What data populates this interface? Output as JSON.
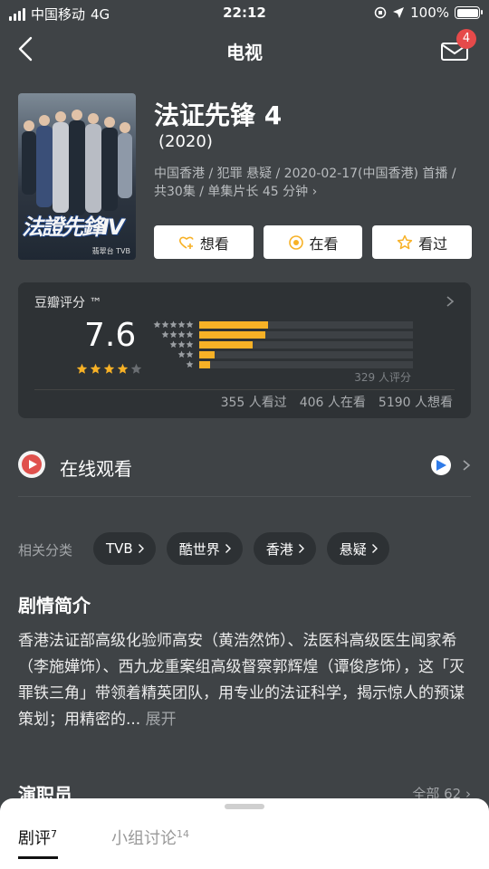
{
  "status_bar": {
    "carrier": "中国移动",
    "network": "4G",
    "time": "22:12",
    "battery_percent": "100%",
    "battery_level": 1.0
  },
  "nav": {
    "title": "电视",
    "mail_badge": "4",
    "icons": [
      "back-arrow-icon",
      "mail-icon"
    ]
  },
  "movie": {
    "title": "法证先锋 4",
    "year": "(2020)",
    "meta": "中国香港 / 犯罪 悬疑 / 2020-02-17(中国香港) 首播 / 共30集 / 单集片长 45 分钟",
    "poster": {
      "logo_text": "法證先鋒IV",
      "channel": "翡翠台 TVB"
    }
  },
  "actions": [
    {
      "label": "想看",
      "icon": "heart-plus-icon"
    },
    {
      "label": "在看",
      "icon": "target-icon"
    },
    {
      "label": "看过",
      "icon": "star-outline-icon"
    }
  ],
  "rating": {
    "label": "豆瓣评分 ™",
    "score": "7.6",
    "stars": 4,
    "distribution": [
      {
        "stars": 5,
        "percent": 32
      },
      {
        "stars": 4,
        "percent": 31
      },
      {
        "stars": 3,
        "percent": 25
      },
      {
        "stars": 2,
        "percent": 7
      },
      {
        "stars": 1,
        "percent": 5
      }
    ],
    "count": "329 人评分",
    "stats": [
      "355 人看过",
      "406 人在看",
      "5190 人想看"
    ]
  },
  "online": {
    "label": "在线观看"
  },
  "tags": {
    "label": "相关分类",
    "items": [
      "TVB",
      "酷世界",
      "香港",
      "悬疑"
    ]
  },
  "synopsis": {
    "title": "剧情简介",
    "text": "香港法证部高级化验师高安（黄浩然饰）、法医科高级医生闻家希（李施嬅饰）、西九龙重案组高级督察郭辉煌（谭俊彦饰），这「灭罪铁三角」带领着精英团队，用专业的法证科学，揭示惊人的预谋策划；用精密的...",
    "more": "展开"
  },
  "cast": {
    "title": "演职员",
    "all": "全部 62"
  },
  "bottom_tabs": [
    {
      "label": "剧评",
      "count": "7"
    },
    {
      "label": "小组讨论",
      "count": "14"
    }
  ]
}
